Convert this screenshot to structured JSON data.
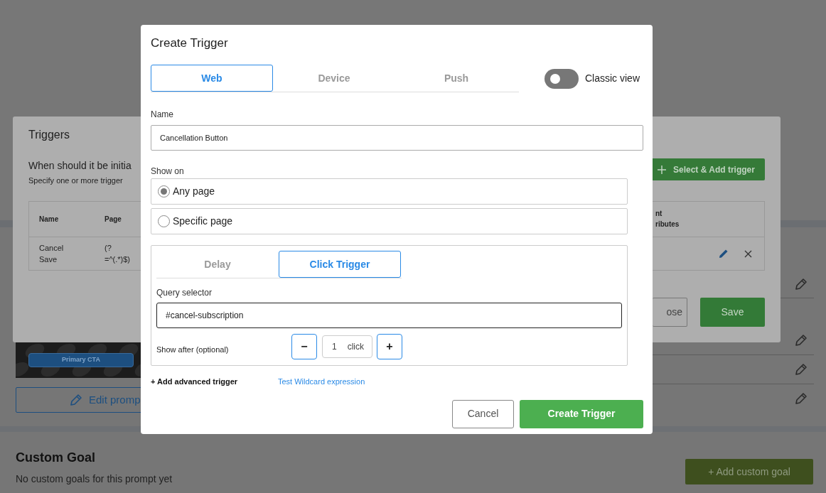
{
  "background_page": {
    "preview": {
      "kind": "picture",
      "cta": "Primary CTA"
    },
    "edit_button": "Edit promp",
    "custom_goal": {
      "title": "Custom Goal",
      "text": "No custom goals for this prompt yet",
      "button": "+ Add custom goal"
    }
  },
  "triggers_dialog": {
    "title": "Triggers",
    "heading": "When should it be initia",
    "subheading": "Specify one or more trigger",
    "add_button": "Select & Add trigger",
    "table": {
      "columns": [
        "Name",
        "Page",
        "nt\nributes"
      ],
      "rows": [
        {
          "cells": [
            "Cancel\nSave",
            "(?\n=^(.*)$)"
          ]
        }
      ]
    },
    "close_button": "ose",
    "save_button": "Save"
  },
  "create_trigger": {
    "title": "Create Trigger",
    "platform_tabs": [
      {
        "label": "Web",
        "selected": true
      },
      {
        "label": "Device",
        "selected": false
      },
      {
        "label": "Push",
        "selected": false
      }
    ],
    "classic_view": {
      "label": "Classic view",
      "on": false
    },
    "name": {
      "label": "Name",
      "value": "Cancellation Button"
    },
    "show_on": {
      "label": "Show on",
      "options": [
        {
          "label": "Any page",
          "selected": true
        },
        {
          "label": "Specific page",
          "selected": false
        }
      ]
    },
    "trigger_tabs": [
      {
        "label": "Delay",
        "selected": false
      },
      {
        "label": "Click Trigger",
        "selected": true
      }
    ],
    "query_selector": {
      "label": "Query selector",
      "value": "#cancel-subscription"
    },
    "show_after": {
      "label": "Show after (optional)",
      "minus": "−",
      "count": "1",
      "unit": "click",
      "plus": "+"
    },
    "add_advanced": "+ Add advanced trigger",
    "test_link": "Test Wildcard expression",
    "cancel_button": "Cancel",
    "submit_button": "Create Trigger"
  }
}
